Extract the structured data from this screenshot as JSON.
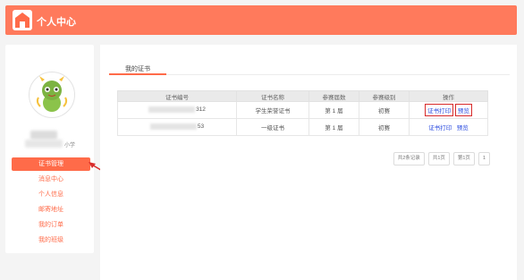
{
  "header": {
    "title": "个人中心",
    "logo_icon": "home-logo-icon"
  },
  "profile": {
    "school_suffix": "小学",
    "avatar_icon": "green-mascot-avatar"
  },
  "menu": [
    {
      "label": "证书管理",
      "active": true
    },
    {
      "label": "消息中心",
      "active": false
    },
    {
      "label": "个人信息",
      "active": false
    },
    {
      "label": "邮寄地址",
      "active": false
    },
    {
      "label": "我的订单",
      "active": false
    },
    {
      "label": "我的班级",
      "active": false
    }
  ],
  "tabs": {
    "active": "我的证书"
  },
  "table": {
    "headers": [
      "证书编号",
      "证书名称",
      "参赛届数",
      "参赛级别",
      "操作"
    ],
    "rows": [
      {
        "id_suffix": "312",
        "name": "学生荣誉证书",
        "session": "第 1 届",
        "level": "初赛",
        "print": "证书打印",
        "preview": "预览",
        "highlight": true
      },
      {
        "id_suffix": "53",
        "name": "一级证书",
        "session": "第 1 届",
        "level": "初赛",
        "print": "证书打印",
        "preview": "预览",
        "highlight": false
      }
    ]
  },
  "pager": {
    "total": "共2条记录",
    "pages": "共1页",
    "current": "第1页",
    "page_num": "1"
  },
  "colors": {
    "accent": "#ff6b49",
    "header_bg": "#ff7a5c",
    "link": "#2f4fe0",
    "highlight": "#d82b2b"
  }
}
